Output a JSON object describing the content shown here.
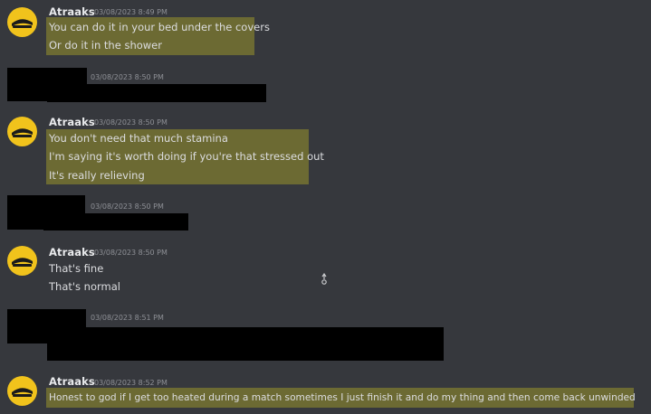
{
  "colors": {
    "background": "#36383d",
    "highlight": "#6c6a33",
    "avatar": "#f1c31c",
    "username": "#e9eaec",
    "timestamp": "#8e9096",
    "message_text": "#dcdde0",
    "redaction": "#000000"
  },
  "groups": [
    {
      "author": "Atraaks",
      "timestamp": "03/08/2023 8:49 PM",
      "highlighted": true,
      "messages": [
        "You can do it in your bed under the covers",
        "Or do it in the shower"
      ]
    },
    {
      "author": "",
      "redacted": true,
      "timestamp": "03/08/2023 8:50 PM"
    },
    {
      "author": "Atraaks",
      "timestamp": "03/08/2023 8:50 PM",
      "highlighted": true,
      "messages": [
        "You don't need that much stamina",
        "I'm saying it's worth doing if you're that stressed out",
        "It's really relieving"
      ]
    },
    {
      "author": "",
      "redacted": true,
      "timestamp": "03/08/2023 8:50 PM"
    },
    {
      "author": "Atraaks",
      "timestamp": "03/08/2023 8:50 PM",
      "highlighted": false,
      "messages": [
        "That's fine",
        "That's normal"
      ]
    },
    {
      "author": "",
      "redacted": true,
      "timestamp": "03/08/2023 8:51 PM"
    },
    {
      "author": "Atraaks",
      "timestamp": "03/08/2023 8:52 PM",
      "highlighted": true,
      "messages": [
        "Honest to god if I get too heated during a match sometimes I just finish it and do my thing and then come back unwinded"
      ]
    }
  ]
}
